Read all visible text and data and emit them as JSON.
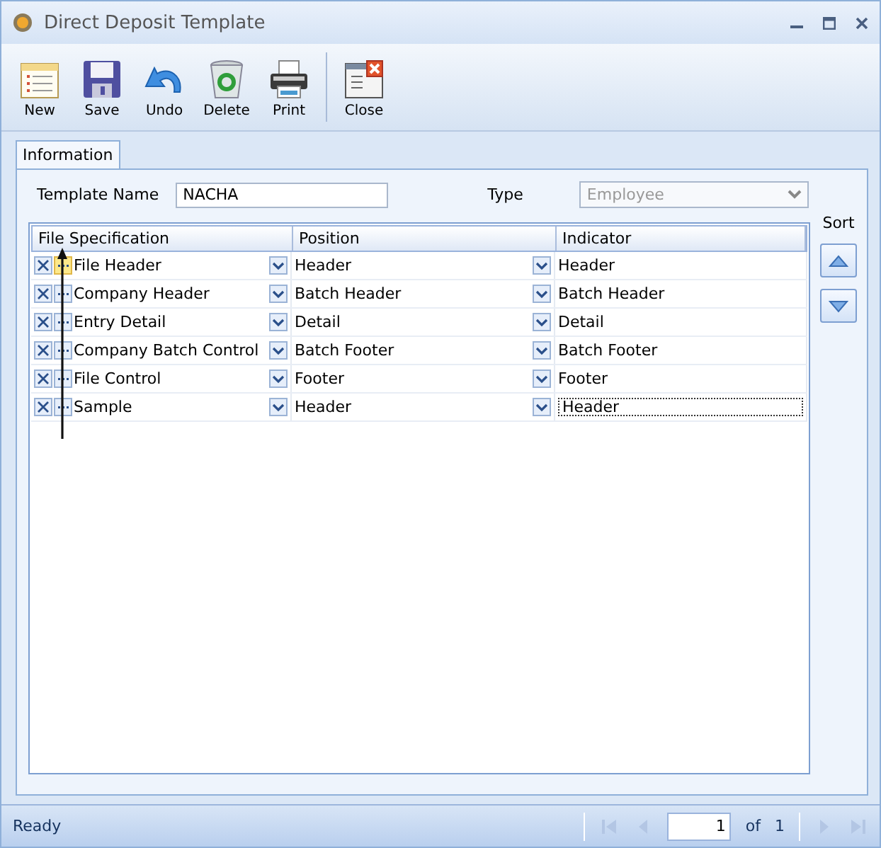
{
  "window": {
    "title": "Direct Deposit Template"
  },
  "toolbar": {
    "groups": [
      [
        {
          "kind": "new",
          "label": "New"
        },
        {
          "kind": "save",
          "label": "Save"
        },
        {
          "kind": "undo",
          "label": "Undo"
        },
        {
          "kind": "delete",
          "label": "Delete"
        },
        {
          "kind": "print",
          "label": "Print"
        }
      ],
      [
        {
          "kind": "close",
          "label": "Close"
        }
      ]
    ]
  },
  "tabs": [
    {
      "label": "Information",
      "selected": true
    }
  ],
  "form": {
    "template_name": {
      "label": "Template Name",
      "value": "NACHA"
    },
    "type": {
      "label": "Type",
      "value": "Employee",
      "disabled": true
    }
  },
  "grid": {
    "columns": [
      "File Specification",
      "Position",
      "Indicator"
    ],
    "rows": [
      {
        "file_specification": "File Header",
        "position": "Header",
        "indicator": "Header",
        "highlighted": true,
        "focused": false
      },
      {
        "file_specification": "Company Header",
        "position": "Batch Header",
        "indicator": "Batch Header",
        "highlighted": false,
        "focused": false
      },
      {
        "file_specification": "Entry Detail",
        "position": "Detail",
        "indicator": "Detail",
        "highlighted": false,
        "focused": false
      },
      {
        "file_specification": "Company Batch Control",
        "position": "Batch Footer",
        "indicator": "Batch Footer",
        "highlighted": false,
        "focused": false
      },
      {
        "file_specification": "File Control",
        "position": "Footer",
        "indicator": "Footer",
        "highlighted": false,
        "focused": false
      },
      {
        "file_specification": "Sample",
        "position": "Header",
        "indicator": "Header",
        "highlighted": false,
        "focused": true
      }
    ]
  },
  "sort": {
    "label": "Sort"
  },
  "status_bar": {
    "text": "Ready",
    "page": "1",
    "of_label": "of",
    "total": "1"
  }
}
